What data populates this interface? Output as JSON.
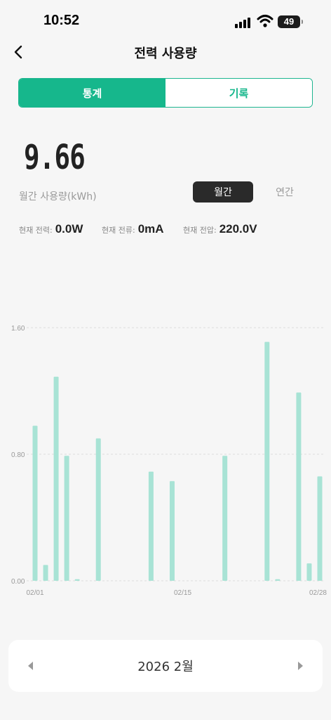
{
  "status": {
    "time": "10:52",
    "battery": "49"
  },
  "header": {
    "title": "전력 사용량"
  },
  "tabs": [
    {
      "label": "통계",
      "active": true
    },
    {
      "label": "기록",
      "active": false
    }
  ],
  "summary": {
    "value": "9.66",
    "label": "월간 사용량(kWh)"
  },
  "period": {
    "monthly": "월간",
    "yearly": "연간",
    "selected": "월간"
  },
  "metrics": [
    {
      "label": "현재 전력:",
      "value": "0.0W"
    },
    {
      "label": "현재 전류:",
      "value": "0mA"
    },
    {
      "label": "현재 전압:",
      "value": "220.0V"
    }
  ],
  "colors": {
    "accent": "#16b78c",
    "bar": "#a8e3d5"
  },
  "chart_data": {
    "type": "bar",
    "ylim": [
      0,
      1.6
    ],
    "yticks": [
      "0.00",
      "0.80",
      "1.60"
    ],
    "xtick_labels": [
      "02/01",
      "02/15",
      "02/28"
    ],
    "grid": true,
    "categories": [
      "02/01",
      "02/02",
      "02/03",
      "02/04",
      "02/05",
      "02/06",
      "02/07",
      "02/08",
      "02/09",
      "02/10",
      "02/11",
      "02/12",
      "02/13",
      "02/14",
      "02/15",
      "02/16",
      "02/17",
      "02/18",
      "02/19",
      "02/20",
      "02/21",
      "02/22",
      "02/23",
      "02/24",
      "02/25",
      "02/26",
      "02/27",
      "02/28"
    ],
    "values": [
      0.98,
      0.1,
      1.29,
      0.79,
      0.01,
      0,
      0.9,
      0,
      0,
      0,
      0,
      0.69,
      0,
      0.63,
      0,
      0,
      0,
      0,
      0.79,
      0,
      0,
      0,
      1.51,
      0.01,
      0,
      1.19,
      0.11,
      0.66
    ]
  },
  "footer": {
    "month": "2026 2월",
    "prev_icon": "chevron-left-icon",
    "next_icon": "chevron-right-icon"
  }
}
